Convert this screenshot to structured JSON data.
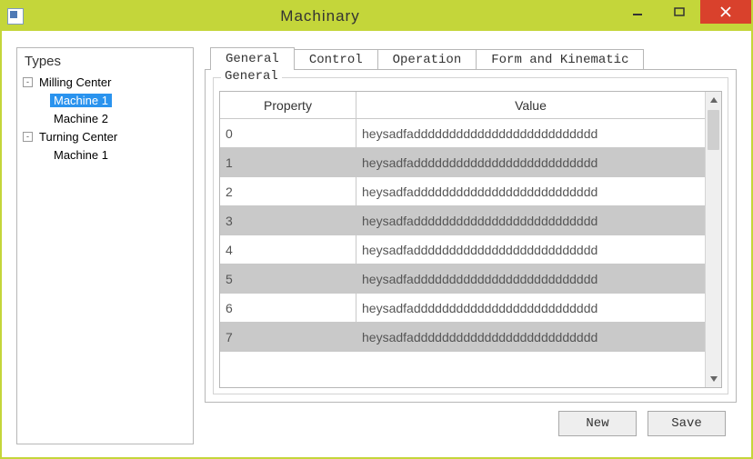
{
  "window": {
    "title": "Machinary"
  },
  "tree": {
    "title": "Types",
    "nodes": [
      {
        "label": "Milling Center",
        "expandable": true,
        "level": 0,
        "selected": false
      },
      {
        "label": "Machine 1",
        "expandable": false,
        "level": 1,
        "selected": true
      },
      {
        "label": "Machine 2",
        "expandable": false,
        "level": 1,
        "selected": false
      },
      {
        "label": "Turning Center",
        "expandable": true,
        "level": 0,
        "selected": false
      },
      {
        "label": "Machine 1",
        "expandable": false,
        "level": 1,
        "selected": false
      }
    ],
    "expander_glyph": "-"
  },
  "tabs": [
    {
      "label": "General",
      "active": true
    },
    {
      "label": "Control",
      "active": false
    },
    {
      "label": "Operation",
      "active": false
    },
    {
      "label": "Form and Kinematic",
      "active": false
    }
  ],
  "fieldset": {
    "legend": "General"
  },
  "grid": {
    "headers": {
      "property": "Property",
      "value": "Value"
    },
    "rows": [
      {
        "property": "0",
        "value": "heysadfadddddddddddddddddddddddddd"
      },
      {
        "property": "1",
        "value": "heysadfadddddddddddddddddddddddddd"
      },
      {
        "property": "2",
        "value": "heysadfadddddddddddddddddddddddddd"
      },
      {
        "property": "3",
        "value": "heysadfadddddddddddddddddddddddddd"
      },
      {
        "property": "4",
        "value": "heysadfadddddddddddddddddddddddddd"
      },
      {
        "property": "5",
        "value": "heysadfadddddddddddddddddddddddddd"
      },
      {
        "property": "6",
        "value": "heysadfadddddddddddddddddddddddddd"
      },
      {
        "property": "7",
        "value": "heysadfadddddddddddddddddddddddddd"
      }
    ]
  },
  "buttons": {
    "new": "New",
    "save": "Save"
  }
}
